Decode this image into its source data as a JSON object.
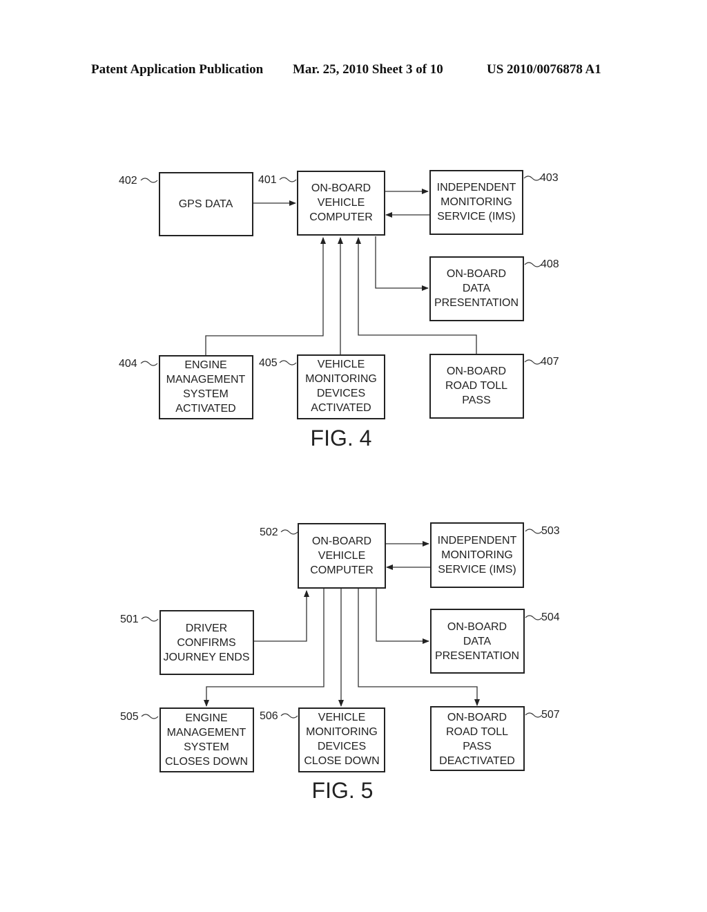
{
  "header": {
    "left": "Patent Application Publication",
    "middle": "Mar. 25, 2010  Sheet 3 of 10",
    "right": "US 2010/0076878 A1"
  },
  "fig4": {
    "caption": "FIG. 4",
    "boxes": {
      "401": {
        "ref": "401",
        "lines": [
          "ON-BOARD",
          "VEHICLE",
          "COMPUTER"
        ]
      },
      "402": {
        "ref": "402",
        "lines": [
          "GPS DATA"
        ]
      },
      "403": {
        "ref": "403",
        "lines": [
          "INDEPENDENT",
          "MONITORING",
          "SERVICE (IMS)"
        ]
      },
      "404": {
        "ref": "404",
        "lines": [
          "ENGINE",
          "MANAGEMENT",
          "SYSTEM",
          "ACTIVATED"
        ]
      },
      "405": {
        "ref": "405",
        "lines": [
          "VEHICLE",
          "MONITORING",
          "DEVICES",
          "ACTIVATED"
        ]
      },
      "407": {
        "ref": "407",
        "lines": [
          "ON-BOARD",
          "ROAD TOLL",
          "PASS"
        ]
      },
      "408": {
        "ref": "408",
        "lines": [
          "ON-BOARD",
          "DATA",
          "PRESENTATION"
        ]
      }
    },
    "connections": [
      {
        "from": "402",
        "to": "401"
      },
      {
        "from": "401",
        "to": "403"
      },
      {
        "from": "403",
        "to": "401"
      },
      {
        "from": "401",
        "to": "408"
      },
      {
        "from": "404",
        "to": "401"
      },
      {
        "from": "405",
        "to": "401"
      },
      {
        "from": "407",
        "to": "401"
      }
    ]
  },
  "fig5": {
    "caption": "FIG. 5",
    "boxes": {
      "501": {
        "ref": "501",
        "lines": [
          "DRIVER",
          "CONFIRMS",
          "JOURNEY ENDS"
        ]
      },
      "502": {
        "ref": "502",
        "lines": [
          "ON-BOARD",
          "VEHICLE",
          "COMPUTER"
        ]
      },
      "503": {
        "ref": "503",
        "lines": [
          "INDEPENDENT",
          "MONITORING",
          "SERVICE (IMS)"
        ]
      },
      "504": {
        "ref": "504",
        "lines": [
          "ON-BOARD",
          "DATA",
          "PRESENTATION"
        ]
      },
      "505": {
        "ref": "505",
        "lines": [
          "ENGINE",
          "MANAGEMENT",
          "SYSTEM",
          "CLOSES DOWN"
        ]
      },
      "506": {
        "ref": "506",
        "lines": [
          "VEHICLE",
          "MONITORING",
          "DEVICES",
          "CLOSE DOWN"
        ]
      },
      "507": {
        "ref": "507",
        "lines": [
          "ON-BOARD",
          "ROAD TOLL",
          "PASS",
          "DEACTIVATED"
        ]
      }
    },
    "connections": [
      {
        "from": "501",
        "to": "502"
      },
      {
        "from": "502",
        "to": "503"
      },
      {
        "from": "503",
        "to": "502"
      },
      {
        "from": "502",
        "to": "504"
      },
      {
        "from": "502",
        "to": "505"
      },
      {
        "from": "502",
        "to": "506"
      },
      {
        "from": "502",
        "to": "507"
      }
    ]
  }
}
